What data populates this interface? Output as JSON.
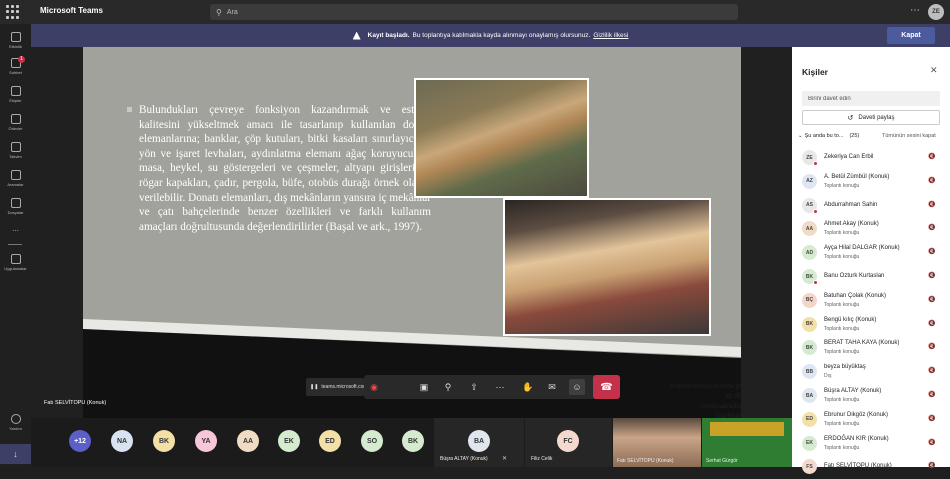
{
  "app": {
    "title": "Microsoft Teams",
    "user_initials": "ZE"
  },
  "search": {
    "placeholder": "Ara"
  },
  "rail": [
    {
      "label": "Etkinlik",
      "icon": "bell-icon"
    },
    {
      "label": "Sohbet",
      "icon": "chat-icon",
      "badge": "1"
    },
    {
      "label": "Ekipler",
      "icon": "teams-icon"
    },
    {
      "label": "Ödevler",
      "icon": "assignments-icon"
    },
    {
      "label": "Takvim",
      "icon": "calendar-icon"
    },
    {
      "label": "Aramalar",
      "icon": "phone-icon"
    },
    {
      "label": "Dosyalar",
      "icon": "files-icon"
    },
    {
      "label": "...",
      "icon": "more-icon"
    },
    {
      "label": "Uygulamalar",
      "icon": "apps-icon"
    },
    {
      "label": "Yardım",
      "icon": "help-icon"
    }
  ],
  "banner": {
    "bold": "Kayıt başladı.",
    "text": "Bu toplantıya katılmakla kayda alınmayı onaylamış olursunuz.",
    "link": "Gizlilik ilkesi",
    "button": "Kapat"
  },
  "slide": {
    "text": "Bulundukları çevreye fonksiyon kazandırmak ve estetik kalitesini yükseltmek amacı ile tasarlanıp kullanılan donatı elemanlarına; banklar, çöp kutuları, bitki kasaları sınırlayıcılar, yön ve işaret levhaları, aydınlatma elemanı ağaç koruyucuları, masa, heykel, su göstergeleri ve çeşmeler, altyapı girişleri ve rögar kapakları, çadır, pergola, büfe, otobüs durağı örnek olarak verilebilir. Donatı elemanları, dış mekânların yansıra iç mekânlar ve çatı bahçelerinde benzer özellikleri ve farklı kullanım amaçları doğrultusunda değerlendirilirler (Başal ve ark., 1997).",
    "url_line1": "tr/mod/resource/view.php?id=8063",
    "url_line2": "ownload/article-file/604891"
  },
  "share_pill": "teams.microsoft.com",
  "presenter": "Fatı SELVİTOPU (Konuk)",
  "call_controls": [
    "record-icon",
    "camera-off-icon",
    "mic-off-icon",
    "share-tray-icon",
    "more-icon",
    "raise-hand-icon",
    "chat-icon",
    "people-icon",
    "hangup-icon"
  ],
  "call_timer": "",
  "strip": {
    "overflow": "+12",
    "avatars": [
      {
        "initials": "NA",
        "color": "#d8e2f0"
      },
      {
        "initials": "BK",
        "color": "#f3e0a6"
      },
      {
        "initials": "YA",
        "color": "#f5c7d8"
      },
      {
        "initials": "AA",
        "color": "#f0dcc4"
      },
      {
        "initials": "EK",
        "color": "#d5ebd0"
      },
      {
        "initials": "ED",
        "color": "#f3e0a6"
      },
      {
        "initials": "SO",
        "color": "#d5ebd0"
      },
      {
        "initials": "BK",
        "color": "#d5ebd0"
      }
    ],
    "tiles": [
      {
        "initials": "BA",
        "color": "#dfe6ee",
        "name": "Büşra ALTAY (Konuk)"
      },
      {
        "initials": "FC",
        "color": "#f4d9cf",
        "name": "Filiz Celik"
      }
    ],
    "video_tiles": [
      {
        "name": "Fatı SELVİTOPU (Konuk)"
      },
      {
        "name": "Serhat Gürgör"
      }
    ]
  },
  "people": {
    "title": "Kişiler",
    "invite_placeholder": "Birini davet edin",
    "share_invite": "Daveti paylaş",
    "section": "Şu anda bu to...",
    "count": "(25)",
    "mute_all": "Tümünün sesini kapat",
    "list": [
      {
        "initials": "ZE",
        "name": "Zekeriya Can Erbil",
        "role": "",
        "color": "#e8e8e8",
        "status": true
      },
      {
        "initials": "AZ",
        "name": "A. Betül Zümbül (Konuk)",
        "role": "Toplantı konuğu",
        "color": "#dfe6f3",
        "status": false
      },
      {
        "initials": "AS",
        "name": "Abdurrahman Sahin",
        "role": "",
        "color": "#e8e8e8",
        "status": true
      },
      {
        "initials": "AA",
        "name": "Ahmet Akay (Konuk)",
        "role": "Toplantı konuğu",
        "color": "#f0dcc4",
        "status": false
      },
      {
        "initials": "AD",
        "name": "Ayça Hilal DALGAR (Konuk)",
        "role": "Toplantı konuğu",
        "color": "#d5ebd0",
        "status": false
      },
      {
        "initials": "BK",
        "name": "Banu Ozturk Kurtaslan",
        "role": "",
        "color": "#d5ebd0",
        "status": true
      },
      {
        "initials": "BÇ",
        "name": "Batuhan Çolak (Konuk)",
        "role": "Toplantı konuğu",
        "color": "#f5d5c8",
        "status": false
      },
      {
        "initials": "BK",
        "name": "Bengü kılıç (Konuk)",
        "role": "Toplantı konuğu",
        "color": "#f3e0a6",
        "status": false
      },
      {
        "initials": "BK",
        "name": "BERAT TAHA KAYA (Konuk)",
        "role": "Toplantı konuğu",
        "color": "#d5ebd0",
        "status": false
      },
      {
        "initials": "BB",
        "name": "beyza büyüktaş",
        "role": "Dış",
        "color": "#dfe6f3",
        "status": false
      },
      {
        "initials": "BA",
        "name": "Büşra ALTAY (Konuk)",
        "role": "Toplantı konuğu",
        "color": "#dfe6ee",
        "status": false
      },
      {
        "initials": "ED",
        "name": "Ebrunur Dikgöz (Konuk)",
        "role": "Toplantı konuğu",
        "color": "#f3e0a6",
        "status": false
      },
      {
        "initials": "EK",
        "name": "ERDOĞAN KIR (Konuk)",
        "role": "Toplantı konuğu",
        "color": "#d5ebd0",
        "status": false
      },
      {
        "initials": "FS",
        "name": "Fatı SELVİTOPU (Konuk)",
        "role": "",
        "color": "#f4d9cf",
        "status": false
      }
    ]
  },
  "colors": {
    "accent": "#4c5a9e",
    "banner": "#3d3f66",
    "hangup": "#c4314b"
  }
}
